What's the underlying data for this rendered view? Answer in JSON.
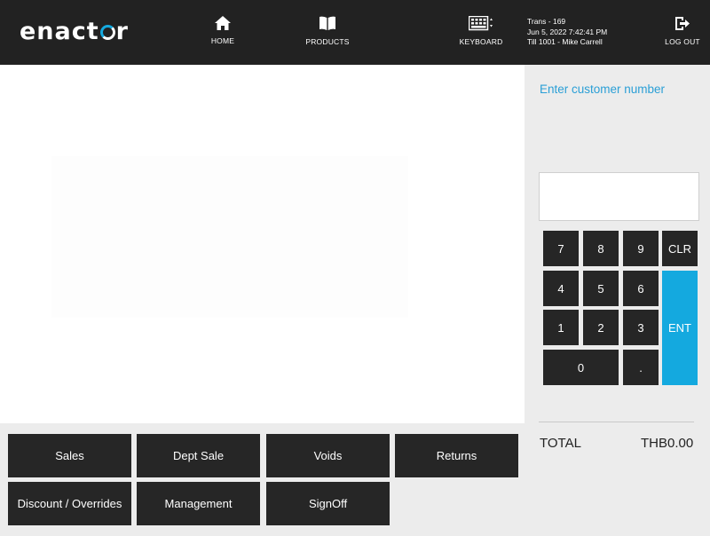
{
  "header": {
    "logo": {
      "pre": "enact",
      "post": "r"
    },
    "nav": {
      "home": "HOME",
      "products": "PRODUCTS",
      "keyboard": "KEYBOARD",
      "logout": "LOG OUT"
    },
    "trans": {
      "line1": "Trans - 169",
      "line2": "Jun 5, 2022 7:42:41 PM",
      "line3": "Till 1001 - Mike Carrell"
    }
  },
  "panel": {
    "prompt": "Enter customer number",
    "keypad": {
      "k7": "7",
      "k8": "8",
      "k9": "9",
      "clr": "CLR",
      "k4": "4",
      "k5": "5",
      "k6": "6",
      "ent": "ENT",
      "k1": "1",
      "k2": "2",
      "k3": "3",
      "k0": "0",
      "dot": "."
    },
    "total_label": "TOTAL",
    "total_value": "THB0.00"
  },
  "functions": {
    "sales": "Sales",
    "dept_sale": "Dept Sale",
    "voids": "Voids",
    "returns": "Returns",
    "discount": "Discount / Overrides",
    "management": "Management",
    "signoff": "SignOff"
  },
  "colors": {
    "header_bg": "#222222",
    "accent": "#14a9df",
    "prompt": "#2a9fd6",
    "button_bg": "#262626",
    "panel_bg": "#ececec"
  },
  "icons": {
    "home": "home-icon",
    "products": "book-icon",
    "keyboard": "keyboard-icon",
    "logout": "logout-icon"
  }
}
